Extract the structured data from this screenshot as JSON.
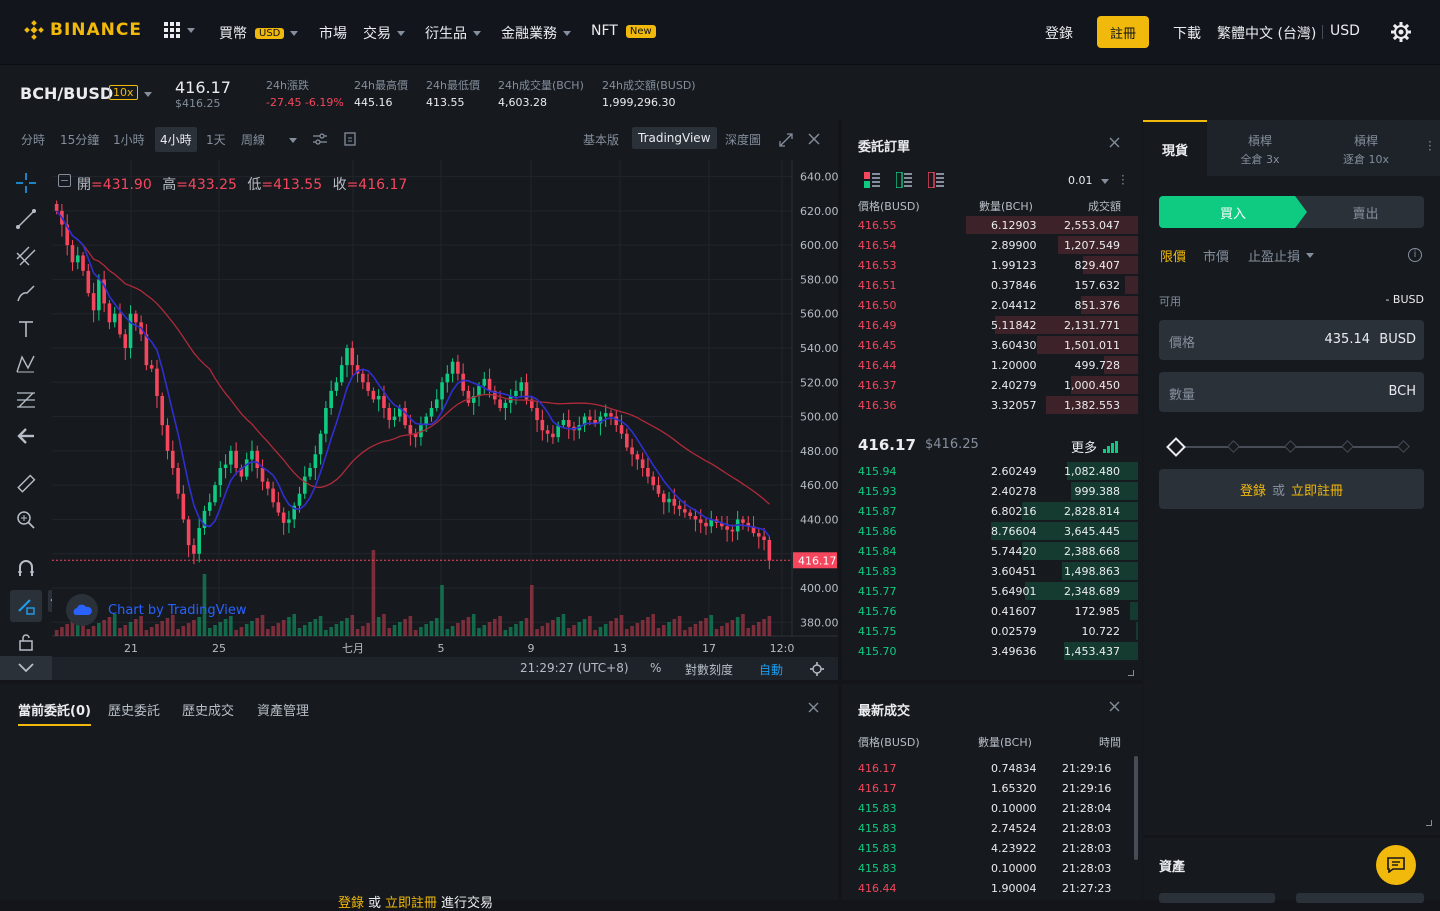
{
  "nav": {
    "logo": "BINANCE",
    "buy_crypto": "買幣",
    "buy_crypto_badge": "USD",
    "markets": "市場",
    "trade": "交易",
    "derivatives": "衍生品",
    "finance": "金融業務",
    "nft": "NFT",
    "nft_badge": "New",
    "login": "登錄",
    "register": "註冊",
    "download": "下載",
    "language": "繁體中文 (台灣)",
    "currency": "USD"
  },
  "ticker": {
    "pair": "BCH/BUSD",
    "leverage": "10x",
    "price": "416.17",
    "price_usd": "$416.25",
    "stats": [
      {
        "label": "24h漲跌",
        "value": "-27.45 -6.19%"
      },
      {
        "label": "24h最高價",
        "value": "445.16"
      },
      {
        "label": "24h最低價",
        "value": "413.55"
      },
      {
        "label": "24h成交量(BCH)",
        "value": "4,603.28"
      },
      {
        "label": "24h成交額(BUSD)",
        "value": "1,999,296.30"
      }
    ]
  },
  "chart_toolbar": {
    "intervals": [
      "分時",
      "15分鐘",
      "1小時",
      "4小時",
      "1天",
      "周線"
    ],
    "active_interval": "4小時",
    "views": [
      "基本版",
      "TradingView",
      "深度圖"
    ],
    "active_view": "TradingView"
  },
  "chart_data": {
    "type": "candlestick",
    "ohlc_label": {
      "open_label": "開",
      "open": "431.90",
      "high_label": "高",
      "high": "433.25",
      "low_label": "低",
      "low": "413.55",
      "close_label": "收",
      "close": "416.17"
    },
    "y_ticks": [
      "640.00",
      "620.00",
      "600.00",
      "580.00",
      "560.00",
      "540.00",
      "520.00",
      "500.00",
      "480.00",
      "460.00",
      "440.00",
      "420.00",
      "400.00",
      "380.00"
    ],
    "ylim": [
      372,
      645
    ],
    "x_ticks": [
      "21",
      "25",
      "七月",
      "5",
      "9",
      "13",
      "17",
      "12:0"
    ],
    "current_price_tag": "416.17",
    "watermark": "Chart by TradingView",
    "closes": [
      620,
      612,
      600,
      590,
      594,
      585,
      572,
      562,
      580,
      566,
      555,
      560,
      548,
      540,
      560,
      555,
      548,
      530,
      528,
      512,
      495,
      480,
      470,
      455,
      440,
      425,
      420,
      435,
      445,
      450,
      460,
      470,
      472,
      480,
      470,
      465,
      475,
      480,
      470,
      462,
      458,
      450,
      444,
      438,
      440,
      448,
      455,
      465,
      470,
      478,
      490,
      505,
      515,
      520,
      530,
      540,
      530,
      525,
      520,
      515,
      510,
      512,
      505,
      498,
      500,
      505,
      495,
      490,
      488,
      495,
      500,
      505,
      510,
      520,
      525,
      532,
      525,
      515,
      508,
      512,
      518,
      522,
      515,
      510,
      505,
      508,
      512,
      515,
      520,
      510,
      505,
      498,
      492,
      490,
      488,
      495,
      498,
      494,
      492,
      495,
      500,
      498,
      496,
      500,
      502,
      500,
      495,
      490,
      482,
      478,
      475,
      470,
      465,
      460,
      455,
      450,
      452,
      448,
      446,
      444,
      442,
      440,
      438,
      436,
      440,
      438,
      436,
      434,
      433,
      440,
      438,
      436,
      432,
      430,
      428,
      416
    ]
  },
  "chart_bottom": {
    "time": "21:29:27 (UTC+8)",
    "percent": "%",
    "log": "對數刻度",
    "auto": "自動"
  },
  "orderbook": {
    "title": "委託訂單",
    "precision": "0.01",
    "headers": [
      "價格(BUSD)",
      "數量(BCH)",
      "成交額"
    ],
    "asks": [
      {
        "price": "416.55",
        "qty": "6.12903",
        "total": "2,553.047",
        "depth": 0.82
      },
      {
        "price": "416.54",
        "qty": "2.89900",
        "total": "1,207.549",
        "depth": 0.38
      },
      {
        "price": "416.53",
        "qty": "1.99123",
        "total": "829.407",
        "depth": 0.26
      },
      {
        "price": "416.51",
        "qty": "0.37846",
        "total": "157.632",
        "depth": 0.06
      },
      {
        "price": "416.50",
        "qty": "2.04412",
        "total": "851.376",
        "depth": 0.27
      },
      {
        "price": "416.49",
        "qty": "5.11842",
        "total": "2,131.771",
        "depth": 0.68
      },
      {
        "price": "416.45",
        "qty": "3.60430",
        "total": "1,501.011",
        "depth": 0.48
      },
      {
        "price": "416.44",
        "qty": "1.20000",
        "total": "499.728",
        "depth": 0.16
      },
      {
        "price": "416.37",
        "qty": "2.40279",
        "total": "1,000.450",
        "depth": 0.32
      },
      {
        "price": "416.36",
        "qty": "3.32057",
        "total": "1,382.553",
        "depth": 0.44
      }
    ],
    "last_price": "416.17",
    "last_price_usd": "$416.25",
    "more": "更多",
    "bids": [
      {
        "price": "415.94",
        "qty": "2.60249",
        "total": "1,082.480",
        "depth": 0.34
      },
      {
        "price": "415.93",
        "qty": "2.40278",
        "total": "999.388",
        "depth": 0.32
      },
      {
        "price": "415.87",
        "qty": "6.80216",
        "total": "2,828.814",
        "depth": 0.55
      },
      {
        "price": "415.86",
        "qty": "8.76604",
        "total": "3,645.445",
        "depth": 0.7
      },
      {
        "price": "415.84",
        "qty": "5.74420",
        "total": "2,388.668",
        "depth": 0.55
      },
      {
        "price": "415.83",
        "qty": "3.60451",
        "total": "1,498.863",
        "depth": 0.36
      },
      {
        "price": "415.77",
        "qty": "5.64901",
        "total": "2,348.689",
        "depth": 0.54
      },
      {
        "price": "415.76",
        "qty": "0.41607",
        "total": "172.985",
        "depth": 0.04
      },
      {
        "price": "415.75",
        "qty": "0.02579",
        "total": "10.722",
        "depth": 0.01
      },
      {
        "price": "415.70",
        "qty": "3.49636",
        "total": "1,453.437",
        "depth": 0.35
      }
    ]
  },
  "spot": {
    "tabs": [
      {
        "label": "現貨",
        "sub": ""
      },
      {
        "label": "槓桿",
        "sub": "全倉 3x"
      },
      {
        "label": "槓桿",
        "sub": "逐倉 10x"
      }
    ],
    "buy": "買入",
    "sell": "賣出",
    "order_types": [
      "限價",
      "市價",
      "止盈止損"
    ],
    "available_label": "可用",
    "available_value": "- BUSD",
    "price_label": "價格",
    "price_value": "435.14",
    "price_unit": "BUSD",
    "amount_label": "數量",
    "amount_unit": "BCH",
    "login": "登錄",
    "or": "或",
    "register_now": "立即註冊"
  },
  "assets": {
    "title": "資產"
  },
  "orders": {
    "tabs": [
      "當前委託(0)",
      "歷史委託",
      "歷史成交",
      "資產管理"
    ],
    "prompt_login": "登錄",
    "prompt_or": "或",
    "prompt_register": "立即註冊",
    "prompt_suffix": "進行交易"
  },
  "trades": {
    "title": "最新成交",
    "headers": [
      "價格(BUSD)",
      "數量(BCH)",
      "時間"
    ],
    "rows": [
      {
        "price": "416.17",
        "qty": "0.74834",
        "time": "21:29:16",
        "side": "sell"
      },
      {
        "price": "416.17",
        "qty": "1.65320",
        "time": "21:29:16",
        "side": "sell"
      },
      {
        "price": "415.83",
        "qty": "0.10000",
        "time": "21:28:04",
        "side": "buy"
      },
      {
        "price": "415.83",
        "qty": "2.74524",
        "time": "21:28:03",
        "side": "buy"
      },
      {
        "price": "415.83",
        "qty": "4.23922",
        "time": "21:28:03",
        "side": "buy"
      },
      {
        "price": "415.83",
        "qty": "0.10000",
        "time": "21:28:03",
        "side": "buy"
      },
      {
        "price": "416.44",
        "qty": "1.90004",
        "time": "21:27:23",
        "side": "sell"
      }
    ]
  },
  "colors": {
    "accent": "#f0b90b",
    "up": "#0ecb81",
    "down": "#f6465d",
    "ma_short": "#2f2fd0",
    "ma_long": "#b02a3a"
  }
}
